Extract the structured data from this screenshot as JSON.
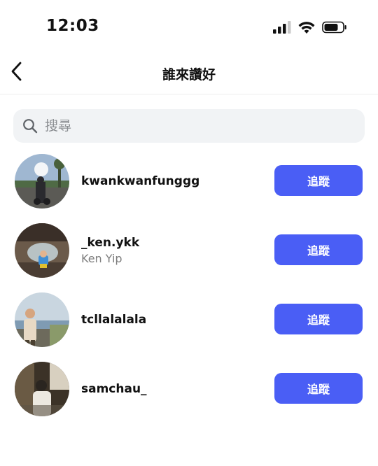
{
  "status_bar": {
    "time": "12:03",
    "icons": [
      "cellular-signal-icon",
      "wifi-icon",
      "battery-icon"
    ]
  },
  "header": {
    "back_icon": "chevron-left-icon",
    "title": "誰來讚好"
  },
  "search": {
    "icon": "search-icon",
    "placeholder": "搜尋",
    "value": ""
  },
  "users": [
    {
      "username": "kwankwanfunggg",
      "fullname": "",
      "button_label": "追蹤"
    },
    {
      "username": "_ken.ykk",
      "fullname": "Ken Yip",
      "button_label": "追蹤"
    },
    {
      "username": "tcllalalala",
      "fullname": "",
      "button_label": "追蹤"
    },
    {
      "username": "samchau_",
      "fullname": "",
      "button_label": "追蹤"
    }
  ],
  "colors": {
    "accent": "#4a5ef5",
    "search_bg": "#f1f3f5",
    "secondary_text": "#7d7d7d"
  }
}
